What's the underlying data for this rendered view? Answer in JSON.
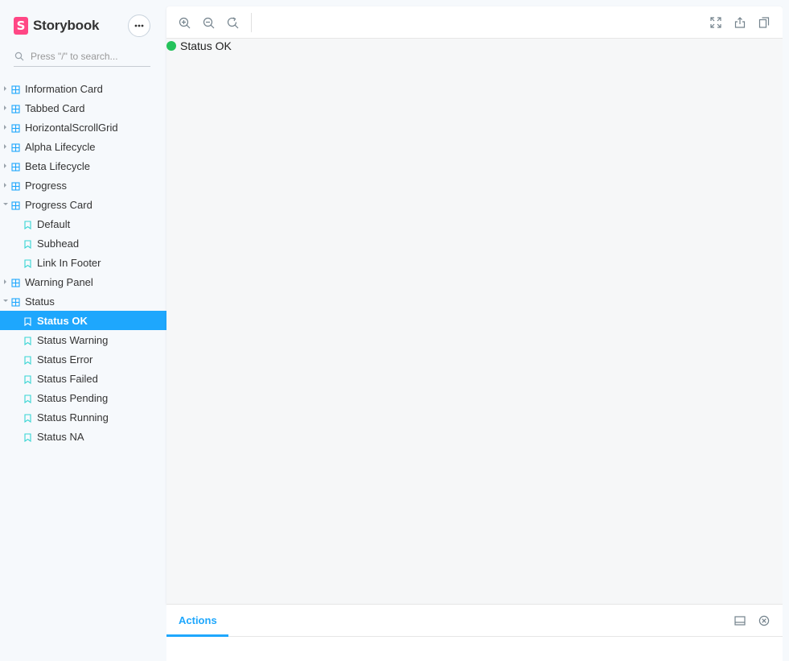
{
  "brand": {
    "logo_letter": "S",
    "name": "Storybook",
    "logo_color": "#ff4785"
  },
  "menu": {
    "icon": "more-horizontal-icon",
    "label": "•••"
  },
  "search": {
    "placeholder": "Press \"/\" to search...",
    "value": ""
  },
  "accent_color": "#1ea7fd",
  "tree": [
    {
      "type": "component",
      "label": "Information Card",
      "expanded": false
    },
    {
      "type": "component",
      "label": "Tabbed Card",
      "expanded": false
    },
    {
      "type": "component",
      "label": "HorizontalScrollGrid",
      "expanded": false
    },
    {
      "type": "component",
      "label": "Alpha Lifecycle",
      "expanded": false
    },
    {
      "type": "component",
      "label": "Beta Lifecycle",
      "expanded": false
    },
    {
      "type": "component",
      "label": "Progress",
      "expanded": false
    },
    {
      "type": "component",
      "label": "Progress Card",
      "expanded": true
    },
    {
      "type": "story",
      "label": "Default"
    },
    {
      "type": "story",
      "label": "Subhead"
    },
    {
      "type": "story",
      "label": "Link In Footer"
    },
    {
      "type": "component",
      "label": "Warning Panel",
      "expanded": false
    },
    {
      "type": "component",
      "label": "Status",
      "expanded": true
    },
    {
      "type": "story",
      "label": "Status OK",
      "selected": true
    },
    {
      "type": "story",
      "label": "Status Warning"
    },
    {
      "type": "story",
      "label": "Status Error"
    },
    {
      "type": "story",
      "label": "Status Failed"
    },
    {
      "type": "story",
      "label": "Status Pending"
    },
    {
      "type": "story",
      "label": "Status Running"
    },
    {
      "type": "story",
      "label": "Status NA"
    }
  ],
  "toolbar": {
    "left": [
      "zoom-in-icon",
      "zoom-out-icon",
      "zoom-reset-icon"
    ],
    "right": [
      "fullscreen-icon",
      "share-icon",
      "copy-link-icon"
    ]
  },
  "preview": {
    "status_text": "Status OK",
    "status_color": "#24c25b"
  },
  "addons": {
    "active_tab": "Actions",
    "buttons": [
      "panel-position-icon",
      "close-panel-icon"
    ]
  }
}
